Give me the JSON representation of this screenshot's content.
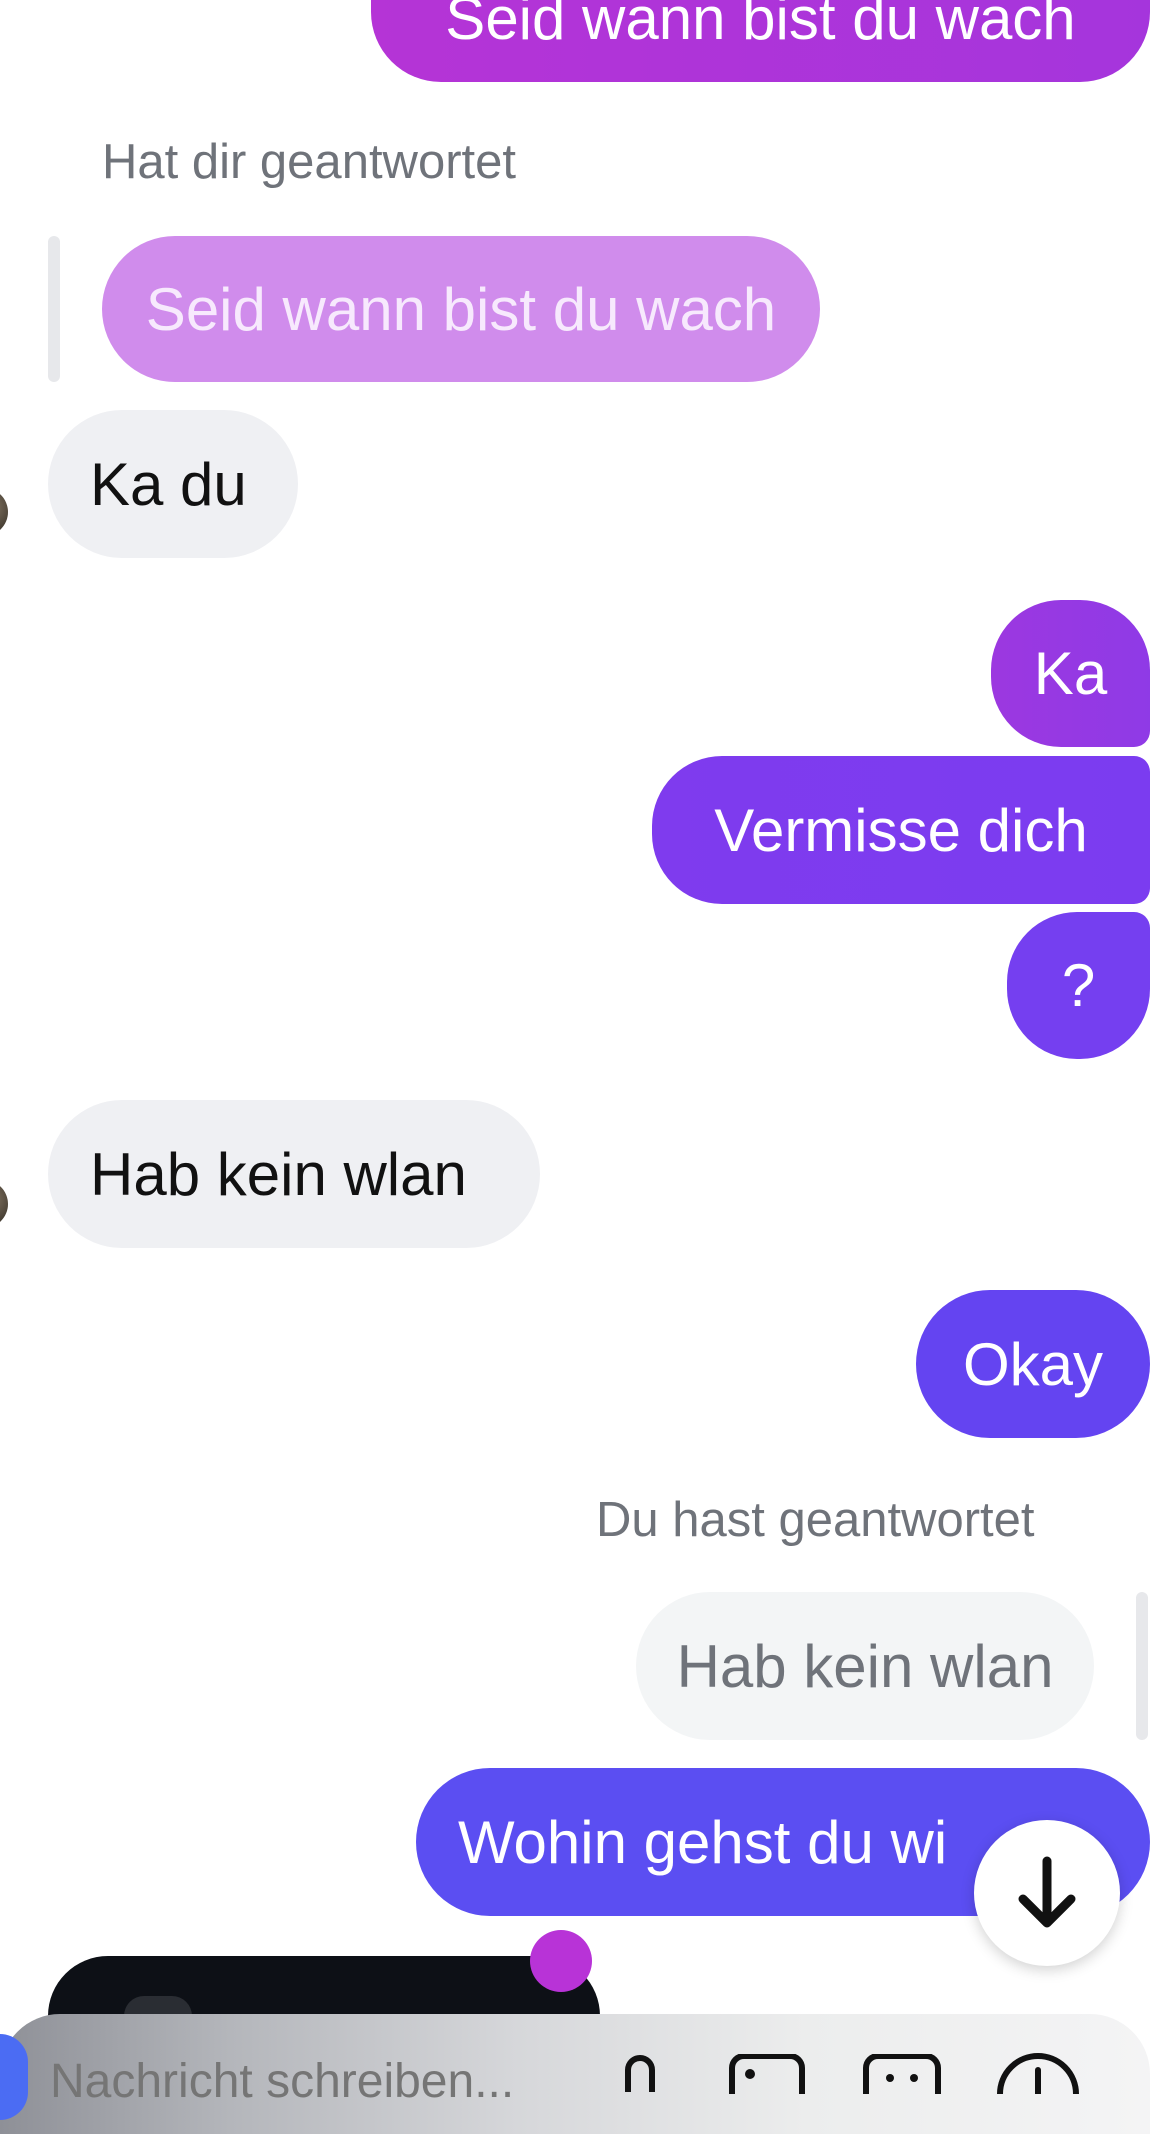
{
  "conversation": {
    "top_message": "Seid wann bist du wach",
    "reply_from_them": {
      "label": "Hat dir geantwortet",
      "quoted": "Seid wann bist du wach"
    },
    "msg_ka_du": "Ka du",
    "msg_ka": "Ka",
    "msg_vermisse": "Vermisse dich",
    "msg_question": "?",
    "msg_hab_kein_wlan": "Hab kein wlan",
    "msg_okay": "Okay",
    "reply_from_you": {
      "label": "Du hast geantwortet",
      "quoted": "Hab kein wlan"
    },
    "msg_wohin": "Wohin gehst du wi"
  },
  "composer": {
    "placeholder": "Nachricht schreiben...",
    "icons": [
      "microphone-icon",
      "image-icon",
      "sticker-icon",
      "plus-icon"
    ]
  },
  "scroll_button": {
    "icon": "arrow-down-icon"
  },
  "colors": {
    "bubble_magenta": "#a437d8",
    "bubble_purple": "#7b3cf0",
    "bubble_indigo": "#5b4ef2",
    "quoted_light": "#d08cec",
    "incoming": "#eff0f3"
  }
}
